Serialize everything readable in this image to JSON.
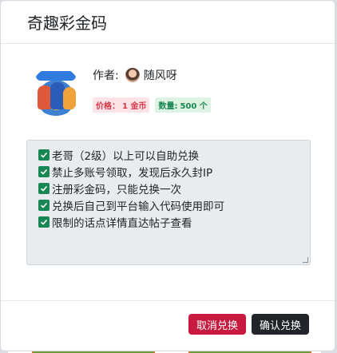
{
  "modal": {
    "title": "奇趣彩金码",
    "author_label": "作者:",
    "author_name": "随风呀",
    "price_label": "价格：",
    "price_value": "1 金币",
    "count_label": "数量:",
    "count_value": "500 个",
    "rules": [
      "老哥（2级）以上可以自助兑换",
      "禁止多账号领取，发现后永久封IP",
      "注册彩金码，只能兑换一次",
      "兑换后自己到平台输入代码使用即可",
      "限制的话点详情直达帖子查看"
    ],
    "cancel_label": "取消兑换",
    "confirm_label": "确认兑换"
  },
  "colors": {
    "cancel": "#c8193f",
    "confirm": "#212529",
    "check": "#198754",
    "price": "#dc3545",
    "count": "#198754"
  },
  "icons": {
    "check": "check-square-icon",
    "cover": "game-cover-image",
    "avatar": "user-avatar"
  }
}
